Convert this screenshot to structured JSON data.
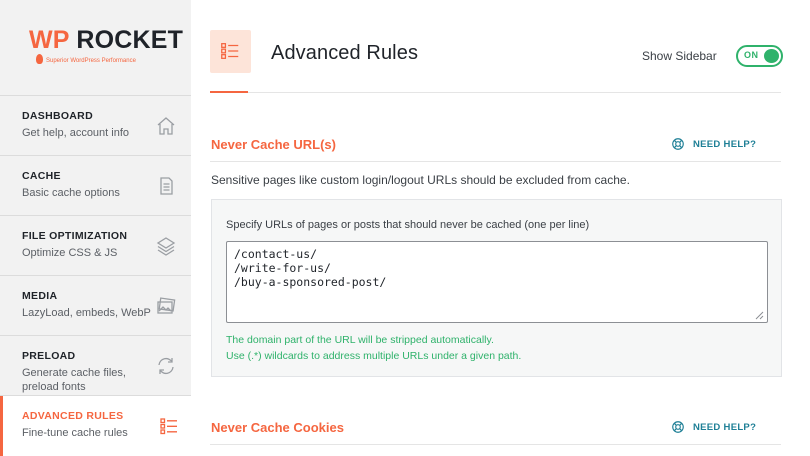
{
  "brand": {
    "name_part1": "WP",
    "name_part2": "ROCKET",
    "tagline": "Superior WordPress Performance"
  },
  "sidebar": {
    "items": [
      {
        "title": "DASHBOARD",
        "subtitle": "Get help, account info",
        "icon": "home-icon",
        "active": false
      },
      {
        "title": "CACHE",
        "subtitle": "Basic cache options",
        "icon": "document-icon",
        "active": false
      },
      {
        "title": "FILE OPTIMIZATION",
        "subtitle": "Optimize CSS & JS",
        "icon": "layers-icon",
        "active": false
      },
      {
        "title": "MEDIA",
        "subtitle": "LazyLoad, embeds, WebP",
        "icon": "images-icon",
        "active": false
      },
      {
        "title": "PRELOAD",
        "subtitle": "Generate cache files, preload fonts",
        "icon": "refresh-icon",
        "active": false
      },
      {
        "title": "ADVANCED RULES",
        "subtitle": "Fine-tune cache rules",
        "icon": "rules-list-icon",
        "active": true
      }
    ]
  },
  "header": {
    "title": "Advanced Rules",
    "show_sidebar_label": "Show Sidebar",
    "toggle_label": "ON",
    "toggle_on": true
  },
  "sections": {
    "never_cache_urls": {
      "title": "Never Cache URL(s)",
      "help_label": "NEED HELP?",
      "description": "Sensitive pages like custom login/logout URLs should be excluded from cache.",
      "field_label": "Specify URLs of pages or posts that should never be cached (one per line)",
      "value": "/contact-us/\n/write-for-us/\n/buy-a-sponsored-post/",
      "hint_1": "The domain part of the URL will be stripped automatically.",
      "hint_2": "Use (.*) wildcards to address multiple URLs under a given path."
    },
    "never_cache_cookies": {
      "title": "Never Cache Cookies",
      "help_label": "NEED HELP?"
    }
  },
  "colors": {
    "accent": "#f56640",
    "success": "#2fb26b",
    "help_link": "#1e7f96"
  }
}
